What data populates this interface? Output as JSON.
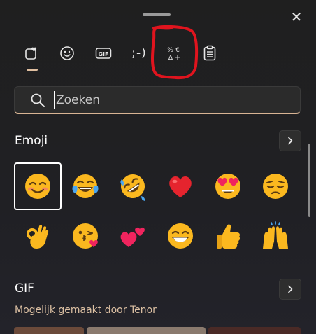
{
  "window": {
    "close_glyph": "✕"
  },
  "tabs": [
    {
      "name": "emoji",
      "icon": "heart-face-icon",
      "selected": true
    },
    {
      "name": "kaomoji-face",
      "icon": "smiley-icon"
    },
    {
      "name": "gif",
      "icon": "gif-icon",
      "label": "GIF"
    },
    {
      "name": "kaomoji",
      "icon": "kaomoji-icon",
      "label": ";-)"
    },
    {
      "name": "symbols",
      "icon": "symbols-icon",
      "label": "%€ Δ+"
    },
    {
      "name": "clipboard",
      "icon": "clipboard-icon"
    }
  ],
  "search": {
    "placeholder": "Zoeken",
    "value": ""
  },
  "emoji_section": {
    "title": "Emoji",
    "items": [
      "smiling-face-with-smiling-eyes",
      "face-with-tears-of-joy",
      "rolling-on-the-floor-laughing",
      "red-heart",
      "smiling-face-with-heart-eyes",
      "pensive-face",
      "ok-hand",
      "face-blowing-a-kiss",
      "two-hearts",
      "beaming-face-with-smiling-eyes",
      "thumbs-up",
      "raising-hands"
    ]
  },
  "gif_section": {
    "title": "GIF",
    "subtitle": "Mogelijk gemaakt door Tenor"
  },
  "colors": {
    "accent": "#d8b494",
    "annotation": "#e0141e"
  }
}
